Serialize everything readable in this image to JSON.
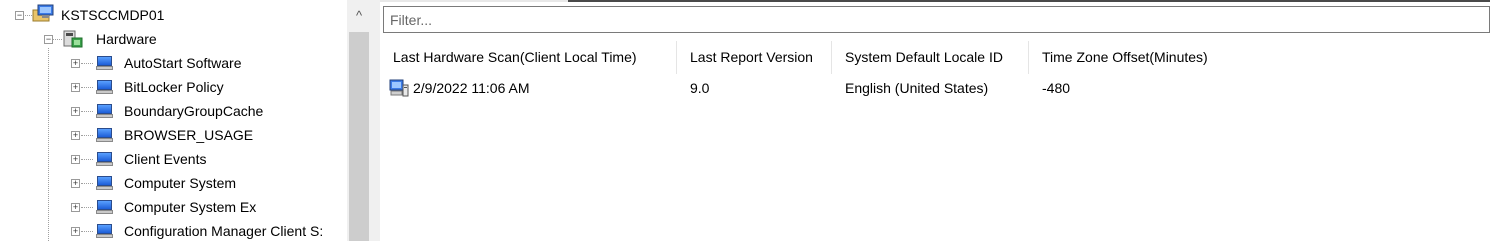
{
  "tree": {
    "root": {
      "label": "KSTSCCMDP01",
      "expanded": true,
      "icon": "computer-folder-icon"
    },
    "hardware": {
      "label": "Hardware",
      "expanded": true,
      "icon": "hardware-node-icon"
    },
    "items": [
      {
        "label": "AutoStart Software",
        "icon": "monitor-icon",
        "expanded": false
      },
      {
        "label": "BitLocker Policy",
        "icon": "monitor-icon",
        "expanded": false
      },
      {
        "label": "BoundaryGroupCache",
        "icon": "monitor-icon",
        "expanded": false
      },
      {
        "label": "BROWSER_USAGE",
        "icon": "monitor-icon",
        "expanded": false
      },
      {
        "label": "Client Events",
        "icon": "monitor-icon",
        "expanded": false
      },
      {
        "label": "Computer System",
        "icon": "monitor-icon",
        "expanded": false
      },
      {
        "label": "Computer System Ex",
        "icon": "monitor-icon",
        "expanded": false
      },
      {
        "label": "Configuration Manager Client S:",
        "icon": "monitor-icon",
        "expanded": false
      }
    ],
    "scroll_up_glyph": "^"
  },
  "filter": {
    "placeholder": "Filter...",
    "value": ""
  },
  "list": {
    "columns": [
      "Last Hardware Scan(Client Local Time)",
      "Last Report Version",
      "System Default Locale ID",
      "Time Zone Offset(Minutes)"
    ],
    "rows": [
      {
        "icon": "hardware-record-icon",
        "cells": [
          "2/9/2022 11:06 AM",
          "9.0",
          "English (United States)",
          "-480"
        ]
      }
    ]
  },
  "colors": {
    "selection_blue": "#1c5ed8",
    "scrollbar_track": "#f0f0f0",
    "scrollbar_thumb": "#cdcdcd"
  }
}
